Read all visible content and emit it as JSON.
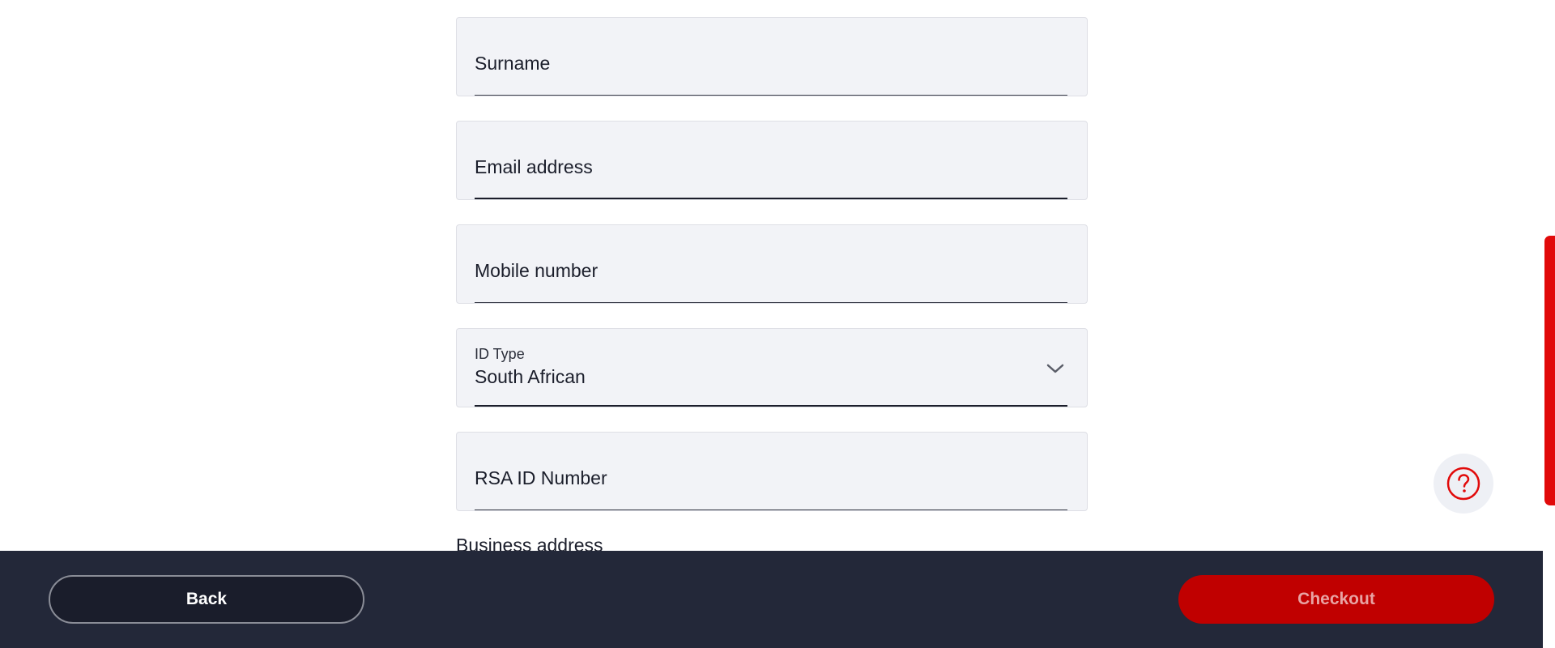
{
  "form": {
    "surname": {
      "placeholder": "Surname",
      "value": ""
    },
    "email": {
      "placeholder": "Email address",
      "value": ""
    },
    "mobile": {
      "placeholder": "Mobile number",
      "value": ""
    },
    "id_type": {
      "label": "ID Type",
      "selected": "South African"
    },
    "rsa_id": {
      "placeholder": "RSA ID Number",
      "value": ""
    },
    "next_section_label": "Business address"
  },
  "footer": {
    "back_label": "Back",
    "checkout_label": "Checkout"
  },
  "icons": {
    "select_chevron": "chevron-down-icon",
    "help": "question-circle-icon"
  },
  "colors": {
    "accent": "#e10a0a",
    "checkout_bg": "#c00000",
    "footer_bg": "#232839",
    "field_bg": "#f2f3f7"
  }
}
